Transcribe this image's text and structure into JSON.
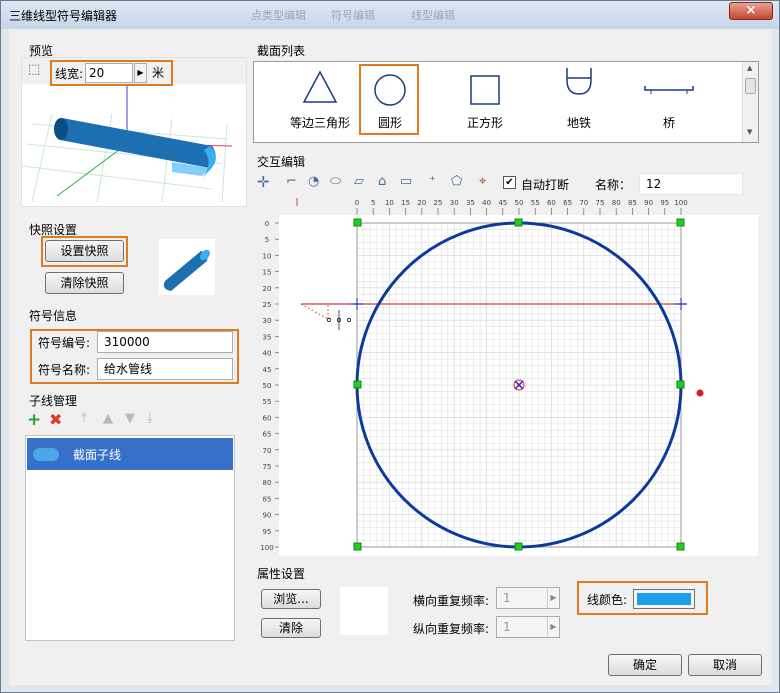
{
  "window": {
    "title": "三维线型符号编辑器",
    "close_glyph": "×",
    "ghost_tabs": [
      "点类型编辑",
      "符号编辑",
      "线型编辑"
    ]
  },
  "preview": {
    "group_label": "预览",
    "line_width_label": "线宽:",
    "line_width_value": "20",
    "unit": "米",
    "tube_color": "#1c6fb0"
  },
  "snapshot": {
    "group_label": "快照设置",
    "set_button": "设置快照",
    "clear_button": "清除快照"
  },
  "symbol_info": {
    "group_label": "符号信息",
    "code_label": "符号编号:",
    "code_value": "310000",
    "name_label": "符号名称:",
    "name_value": "给水管线"
  },
  "subline": {
    "group_label": "子线管理",
    "items": [
      {
        "label": "截面子线"
      }
    ]
  },
  "section_list": {
    "group_label": "截面列表",
    "items": [
      {
        "label": "等边三角形",
        "shape": "triangle"
      },
      {
        "label": "圆形",
        "shape": "circle",
        "selected": true
      },
      {
        "label": "正方形",
        "shape": "square"
      },
      {
        "label": "地铁",
        "shape": "subway"
      },
      {
        "label": "桥",
        "shape": "bridge"
      }
    ]
  },
  "interactive": {
    "group_label": "交互编辑",
    "auto_break_label": "自动打断",
    "auto_break_checked": true,
    "name_label": "名称：",
    "name_value": "12",
    "ruler_ticks": [
      "0",
      "5",
      "10",
      "15",
      "20",
      "25",
      "30",
      "35",
      "40",
      "45",
      "50",
      "55",
      "60",
      "65",
      "70",
      "75",
      "80",
      "85",
      "90",
      "95",
      "100"
    ],
    "circle_color": "#0c3a9c",
    "cross_line_color": "#d63a3a"
  },
  "properties": {
    "group_label": "属性设置",
    "browse_button": "浏览...",
    "clear_button": "清除",
    "h_repeat_label": "横向重复频率:",
    "h_repeat_value": "1",
    "v_repeat_label": "纵向重复频率:",
    "v_repeat_value": "1",
    "line_color_label": "线颜色:",
    "line_color": "#1ea0e8"
  },
  "footer": {
    "ok_button": "确定",
    "cancel_button": "取消"
  }
}
